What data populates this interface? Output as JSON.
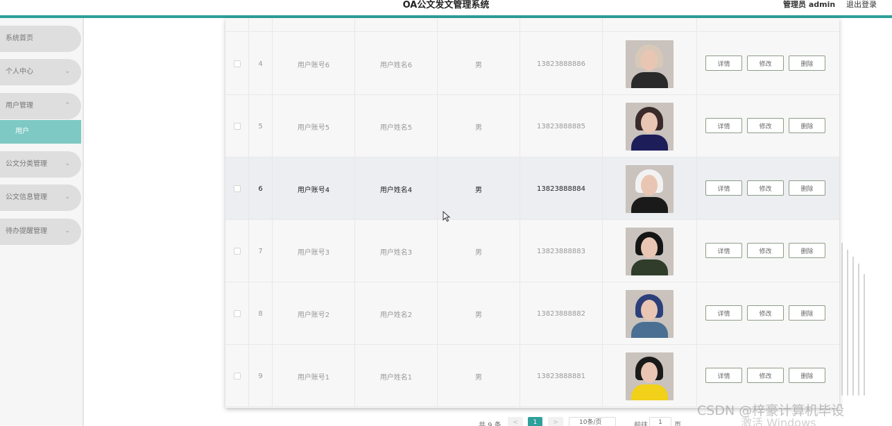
{
  "header": {
    "title": "OA公文发文管理系统",
    "user": "管理员 admin",
    "logout": "退出登录"
  },
  "sidebar": {
    "items": [
      {
        "label": "系统首页"
      },
      {
        "label": "个人中心",
        "chevron": "chevron-down-icon"
      },
      {
        "label": "用户管理",
        "chevron": "chevron-up-icon"
      },
      {
        "label": "公文分类管理",
        "chevron": "chevron-down-icon"
      },
      {
        "label": "公文信息管理",
        "chevron": "chevron-down-icon"
      },
      {
        "label": "待办提醒管理",
        "chevron": "chevron-down-icon"
      }
    ],
    "active_sub": "用户"
  },
  "table": {
    "rows": [
      {
        "index": "4",
        "account": "用户账号6",
        "name": "用户姓名6",
        "sex": "男",
        "phone": "13823888886",
        "avatar_hair": "#d8c8b8",
        "avatar_body": "#2a2a2a"
      },
      {
        "index": "5",
        "account": "用户账号5",
        "name": "用户姓名5",
        "sex": "男",
        "phone": "13823888885",
        "avatar_hair": "#3a2a2a",
        "avatar_body": "#1d1d5a"
      },
      {
        "index": "6",
        "account": "用户账号4",
        "name": "用户姓名4",
        "sex": "男",
        "phone": "13823888884",
        "avatar_hair": "#f2f2f2",
        "avatar_body": "#1a1a1a"
      },
      {
        "index": "7",
        "account": "用户账号3",
        "name": "用户姓名3",
        "sex": "男",
        "phone": "13823888883",
        "avatar_hair": "#151515",
        "avatar_body": "#2f3d2a"
      },
      {
        "index": "8",
        "account": "用户账号2",
        "name": "用户姓名2",
        "sex": "男",
        "phone": "13823888882",
        "avatar_hair": "#2b3f7a",
        "avatar_body": "#4a6f93"
      },
      {
        "index": "9",
        "account": "用户账号1",
        "name": "用户姓名1",
        "sex": "男",
        "phone": "13823888881",
        "avatar_hair": "#1a1a1a",
        "avatar_body": "#f1d11a"
      }
    ],
    "hover_row_index": 2,
    "actions": {
      "detail": "详情",
      "edit": "修改",
      "delete": "删除"
    }
  },
  "pagination": {
    "total": "共 9 条",
    "prev": "<",
    "current": "1",
    "next": ">",
    "page_size": "10条/页",
    "goto_label": "前往",
    "goto_value": "1",
    "page_unit": "页"
  },
  "watermarks": {
    "csdn": "CSDN @梓豪计算机毕设",
    "windows": "激活 Windows"
  }
}
